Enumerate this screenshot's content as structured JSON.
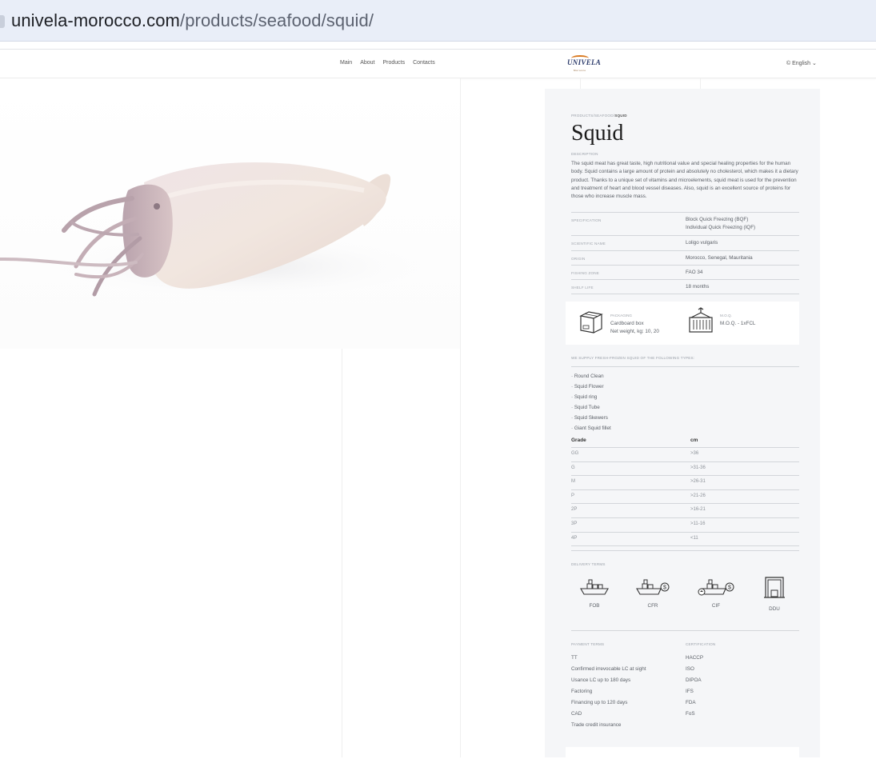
{
  "browser": {
    "url_host": "univela-morocco.com",
    "url_path": "/products/seafood/squid/"
  },
  "nav": {
    "menu": [
      "Main",
      "About",
      "Products",
      "Contacts"
    ],
    "logo_text": "UNIVELA",
    "logo_sub": "Morocco",
    "language": "© English ⌄"
  },
  "product": {
    "breadcrumb_path": "PRODUCTS/SEAFOOD/",
    "breadcrumb_current": "SQUID",
    "title": "Squid",
    "description_label": "DESCRIPTION",
    "description": "The squid meat has great taste, high nutritional value and special healing properties for the human body. Squid contains a large amount of protein and absolutely no cholesterol, which makes it a dietary product. Thanks to a unique set of vitamins and microelements, squid meat is used for the prevention and treatment of heart and blood vessel diseases. Also, squid is an excellent source of proteins for those who increase muscle mass.",
    "specs": [
      {
        "label": "SPECIFICATION",
        "value": "Block Quick Freezing (BQF)",
        "value2": "Individual Quick Freezing (IQF)"
      },
      {
        "label": "SCIENTIFIC NAME",
        "value": "Loligo vulgaris",
        "value2": ""
      },
      {
        "label": "ORIGIN",
        "value": "Morocco, Senegal, Mauritania",
        "value2": ""
      },
      {
        "label": "FISHING ZONE",
        "value": "FAO 34",
        "value2": ""
      },
      {
        "label": "SHELF LIFE",
        "value": "18 months",
        "value2": ""
      }
    ],
    "packaging": {
      "label": "PACKAGING",
      "line1": "Cardboard box",
      "line2": "Net weight, kg: 10, 20"
    },
    "moq": {
      "label": "M.O.Q.",
      "value": "M.O.Q. - 1xFCL"
    },
    "types_label": "WE SUPPLY FRESH-FROZEN SQUID OF THE FOLLOWING TYPES:",
    "types": [
      "· Round Clean",
      "· Squid Flower",
      "· Squid ring",
      "· Squid Tube",
      "· Squid Skewers",
      "· Giant Squid fillet"
    ],
    "grade_table": {
      "headers": [
        "Grade",
        "cm"
      ],
      "rows": [
        [
          "GG",
          ">36"
        ],
        [
          "G",
          ">31-36"
        ],
        [
          "M",
          ">26-31"
        ],
        [
          "P",
          ">21-26"
        ],
        [
          "2P",
          ">16-21"
        ],
        [
          "3P",
          ">11-16"
        ],
        [
          "4P",
          "<11"
        ]
      ]
    },
    "delivery_label": "DELIVERY TERMS",
    "delivery": [
      "FOB",
      "CFR",
      "CIF",
      "DDU"
    ],
    "payment_label": "PAYMENT TERMS",
    "payment": [
      "TT",
      "Confirmed irrevocable LC at sight",
      "Usance LC up to 180 days",
      "Factoring",
      "Financing up to 120 days",
      "CAD",
      "Trade credit insurance"
    ],
    "cert_label": "CERTIFICATION",
    "certs": [
      "HACCP",
      "ISO",
      "DIPOA",
      "IFS",
      "FDA",
      "FoS"
    ]
  },
  "colors": {
    "panel_bg": "#f5f6f8",
    "accent_logo": "#d9781f",
    "logo_blue": "#2b3a6b"
  }
}
